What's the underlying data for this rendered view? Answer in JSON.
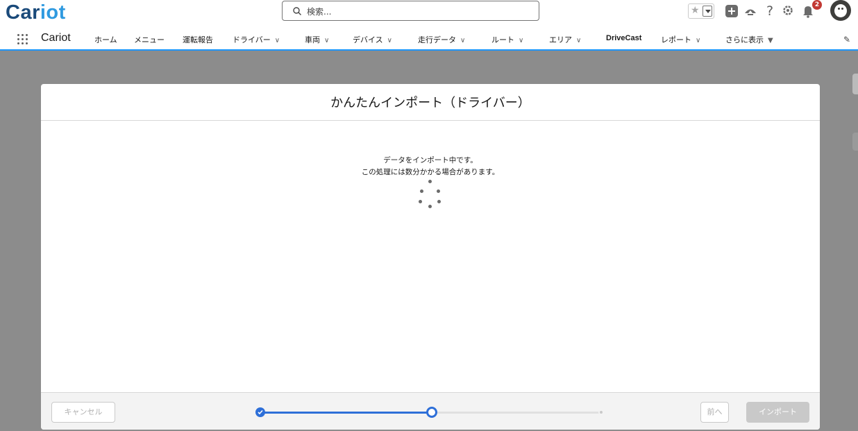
{
  "header": {
    "logo_part1": "Car",
    "logo_part2": "iot",
    "search_placeholder": "検索...",
    "notification_count": "2"
  },
  "nav": {
    "app_name": "Cariot",
    "items": [
      {
        "label": "ホーム",
        "has_chevron": false
      },
      {
        "label": "メニュー",
        "has_chevron": false
      },
      {
        "label": "運転報告",
        "has_chevron": false
      },
      {
        "label": "ドライバー",
        "has_chevron": true
      },
      {
        "label": "車両",
        "has_chevron": true
      },
      {
        "label": "デバイス",
        "has_chevron": true
      },
      {
        "label": "走行データ",
        "has_chevron": true
      },
      {
        "label": "ルート",
        "has_chevron": true
      },
      {
        "label": "エリア",
        "has_chevron": true
      },
      {
        "label": "DriveCast",
        "has_chevron": false
      },
      {
        "label": "レポート",
        "has_chevron": true
      },
      {
        "label": "さらに表示",
        "has_chevron": true
      }
    ]
  },
  "modal": {
    "title": "かんたんインポート（ドライバー）",
    "message_line1": "データをインポート中です。",
    "message_line2": "この処理には数分かかる場合があります。",
    "cancel_label": "キャンセル",
    "prev_label": "前へ",
    "import_label": "インポート",
    "progress": {
      "total_steps": 3,
      "current_step": 2
    }
  },
  "colors": {
    "accent": "#2e6fd8",
    "nav_underline": "#1b96ff",
    "overlay": "#8c8c8c"
  }
}
